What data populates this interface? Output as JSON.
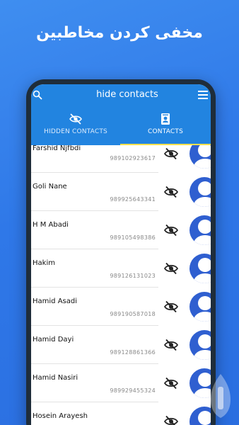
{
  "promo": {
    "title": "مخفی کردن مخاطبین"
  },
  "appbar": {
    "title": "hide contacts",
    "search_icon": "search-icon",
    "menu_icon": "menu-icon"
  },
  "tabs": [
    {
      "label": "HIDDEN CONTACTS",
      "icon": "eye-off-icon",
      "active": false
    },
    {
      "label": "CONTACTS",
      "icon": "contact-card-icon",
      "active": true
    }
  ],
  "contacts": [
    {
      "name": "Farshid Njfbdi",
      "phone": "989102923617"
    },
    {
      "name": "Goli Nane",
      "phone": "989925643341"
    },
    {
      "name": "H M Abadi",
      "phone": "989105498386"
    },
    {
      "name": "Hakim",
      "phone": "989126131023"
    },
    {
      "name": "Hamid Asadi",
      "phone": "989190587018"
    },
    {
      "name": "Hamid Dayi",
      "phone": "989128861366"
    },
    {
      "name": "Hamid Nasiri",
      "phone": "989929455324"
    },
    {
      "name": "Hosein Arayesh",
      "phone": ""
    }
  ],
  "colors": {
    "background": "#2f78e8",
    "appbar": "#2284e0",
    "tab_indicator": "#ffe14d",
    "avatar": "#2f5fd0"
  }
}
